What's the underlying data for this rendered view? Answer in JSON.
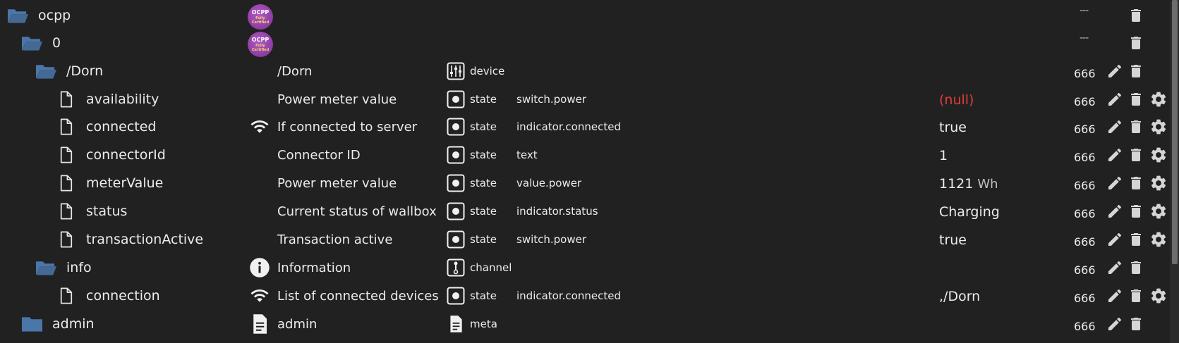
{
  "rows": [
    {
      "object": "ocpp",
      "name": "",
      "type": "",
      "role": "",
      "value": "",
      "acl": "---",
      "kind": "folder-open",
      "logo": true,
      "actions": [
        "delete"
      ]
    },
    {
      "object": "0",
      "name": "",
      "type": "",
      "role": "",
      "value": "",
      "acl": "---",
      "kind": "folder-open",
      "logo": true,
      "actions": [
        "delete"
      ]
    },
    {
      "object": "/Dorn",
      "name": "/Dorn",
      "type": "device",
      "role": "",
      "value": "",
      "acl": "666",
      "kind": "folder-open",
      "type_icon": "device-icon",
      "actions": [
        "edit",
        "delete"
      ]
    },
    {
      "object": "availability",
      "name": "Power meter value",
      "type": "state",
      "role": "switch.power",
      "value": "(null)",
      "value_is_null": true,
      "acl": "666",
      "kind": "file",
      "type_icon": "state-icon",
      "actions": [
        "edit",
        "delete",
        "settings"
      ]
    },
    {
      "object": "connected",
      "name": "If connected to server",
      "name_icon": "wifi-icon",
      "type": "state",
      "role": "indicator.connected",
      "value": "true",
      "acl": "666",
      "kind": "file",
      "type_icon": "state-icon",
      "actions": [
        "edit",
        "delete",
        "settings"
      ]
    },
    {
      "object": "connectorId",
      "name": "Connector ID",
      "type": "state",
      "role": "text",
      "value": "1",
      "acl": "666",
      "kind": "file",
      "type_icon": "state-icon",
      "actions": [
        "edit",
        "delete",
        "settings"
      ]
    },
    {
      "object": "meterValue",
      "name": "Power meter value",
      "type": "state",
      "role": "value.power",
      "value": "1121",
      "unit": "Wh",
      "acl": "666",
      "kind": "file",
      "type_icon": "state-icon",
      "actions": [
        "edit",
        "delete",
        "settings"
      ]
    },
    {
      "object": "status",
      "name": "Current status of wallbox",
      "type": "state",
      "role": "indicator.status",
      "value": "Charging",
      "acl": "666",
      "kind": "file",
      "type_icon": "state-icon",
      "actions": [
        "edit",
        "delete",
        "settings"
      ]
    },
    {
      "object": "transactionActive",
      "name": "Transaction active",
      "type": "state",
      "role": "switch.power",
      "value": "true",
      "acl": "666",
      "kind": "file",
      "type_icon": "state-icon",
      "actions": [
        "edit",
        "delete",
        "settings"
      ]
    },
    {
      "object": "info",
      "name": "Information",
      "name_icon": "info-icon",
      "type": "channel",
      "role": "",
      "value": "",
      "acl": "666",
      "kind": "folder-open",
      "type_icon": "channel-icon",
      "actions": [
        "edit",
        "delete"
      ]
    },
    {
      "object": "connection",
      "name": "List of connected devices",
      "name_icon": "wifi-icon",
      "type": "state",
      "role": "indicator.connected",
      "value": ",/Dorn",
      "acl": "666",
      "kind": "file",
      "type_icon": "state-icon",
      "actions": [
        "edit",
        "delete",
        "settings"
      ]
    },
    {
      "object": "admin",
      "name": "admin",
      "name_icon": "document-icon",
      "type": "meta",
      "role": "",
      "value": "",
      "acl": "666",
      "kind": "folder-closed",
      "type_icon": "meta-icon",
      "actions": [
        "edit",
        "delete"
      ]
    }
  ],
  "logo_text": {
    "line1": "OCPP",
    "line2": "Fully Certified"
  },
  "colors": {
    "background": "#212121",
    "folder": "#4a76a8",
    "text": "#ececec",
    "null_value": "#e23b3b"
  }
}
